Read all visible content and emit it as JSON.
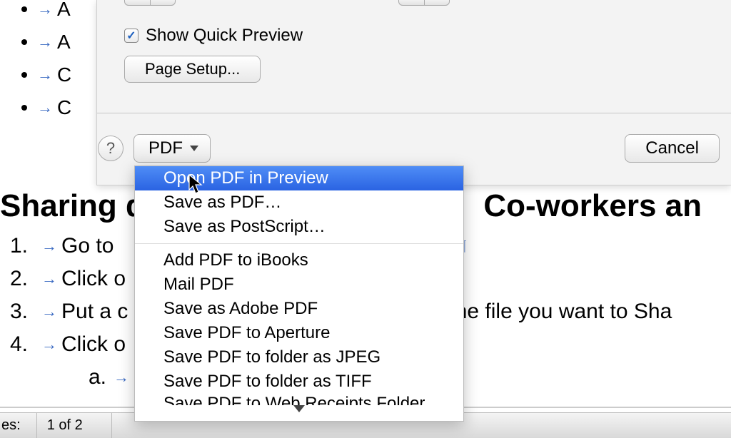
{
  "doc": {
    "bullets": [
      "A",
      "A",
      "C",
      "C"
    ],
    "heading_prefix": "Sharing d",
    "heading_suffix": "Co-workers an",
    "numbered": [
      {
        "num": "1.",
        "prefix": "Go to ",
        "suffix": "in"
      },
      {
        "num": "2.",
        "prefix": "Click o",
        "suffix": ""
      },
      {
        "num": "3.",
        "prefix": "Put a c",
        "suffix": "the file you want to Sha"
      },
      {
        "num": "4.",
        "prefix": "Click o",
        "suffix": ""
      }
    ],
    "sub": {
      "letter": "a."
    }
  },
  "dialog": {
    "show_quick_preview_label": "Show Quick Preview",
    "page_setup_label": "Page Setup...",
    "help_symbol": "?",
    "pdf_button_label": "PDF",
    "cancel_label": "Cancel"
  },
  "menu": {
    "group1": [
      "Open PDF in Preview",
      "Save as PDF…",
      "Save as PostScript…"
    ],
    "group2": [
      "Add PDF to iBooks",
      "Mail PDF",
      "Save as Adobe PDF",
      "Save PDF to Aperture",
      "Save PDF to folder as JPEG",
      "Save PDF to folder as TIFF",
      "Save PDF to Web Receipts Folder"
    ],
    "highlighted_index": 0
  },
  "status": {
    "pages_label": "es:",
    "pages_value": "1 of 2"
  }
}
